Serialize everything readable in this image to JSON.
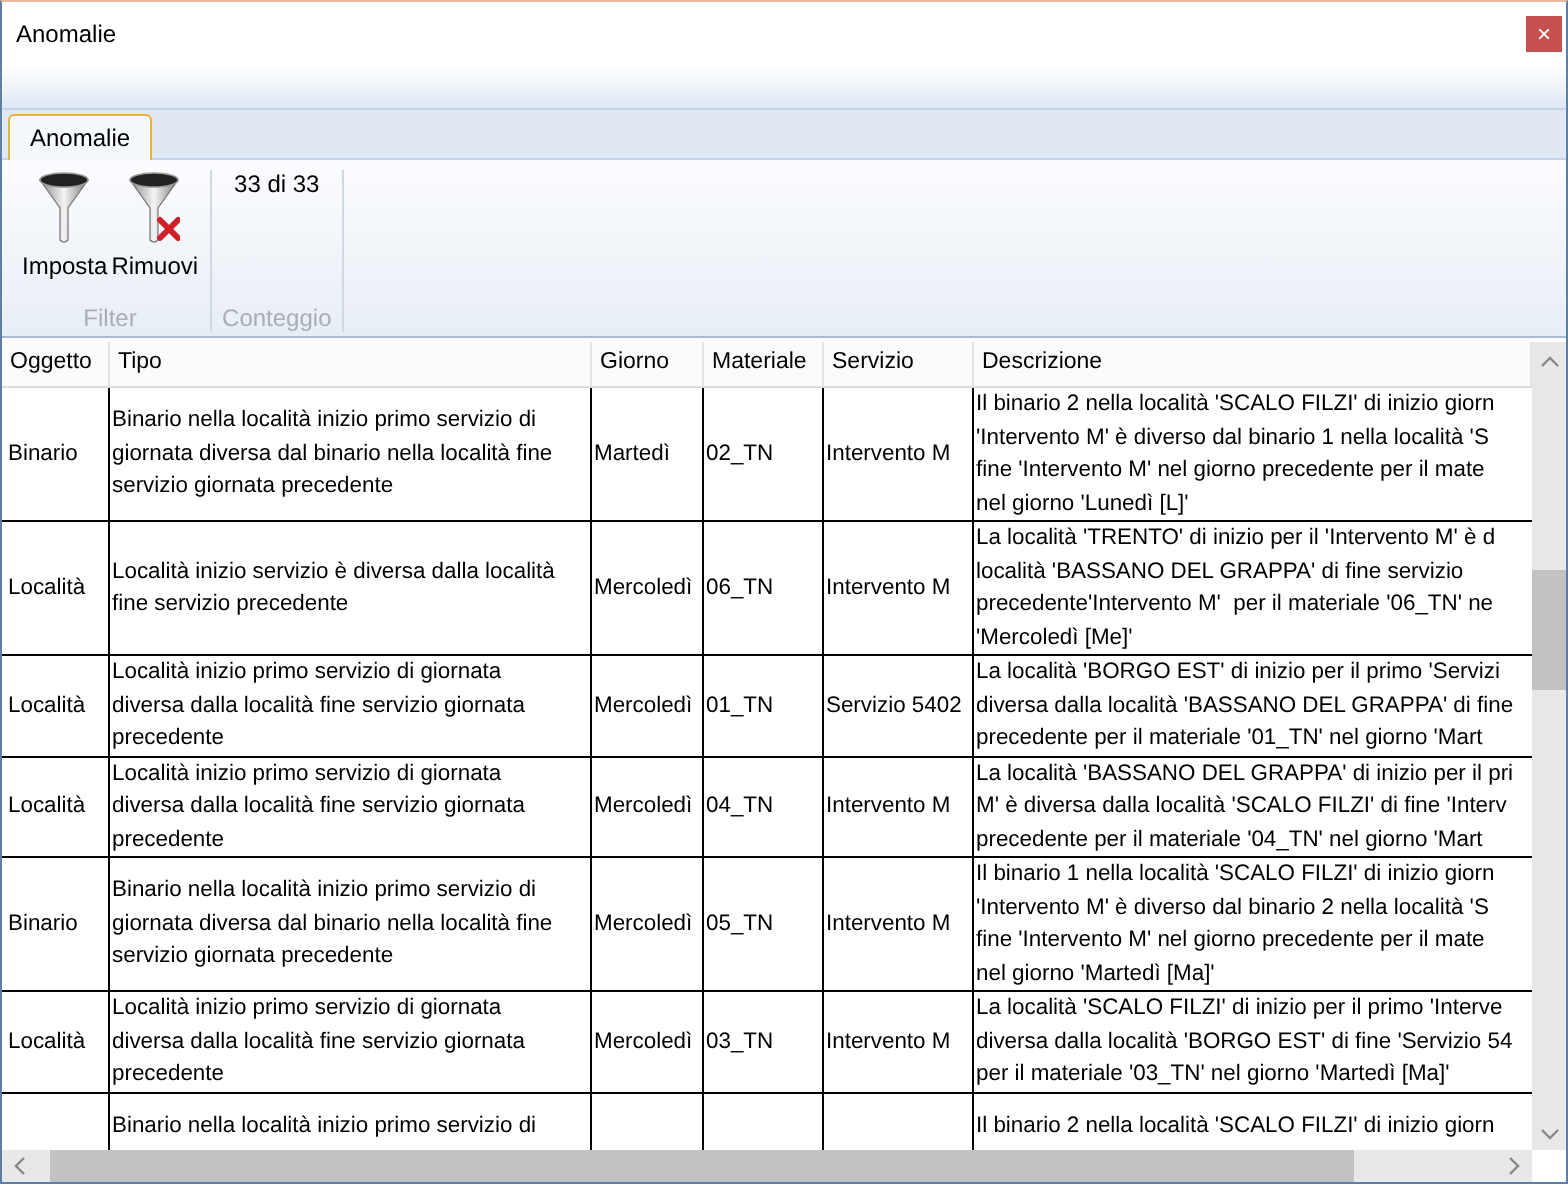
{
  "window": {
    "title": "Anomalie",
    "close": "×"
  },
  "ribbon": {
    "tabs": [
      {
        "label": "Anomalie",
        "selected": true
      }
    ],
    "groups": [
      {
        "label": "Filter",
        "buttons": [
          {
            "label": "Imposta",
            "kind": "funnel"
          },
          {
            "label": "Rimuovi",
            "kind": "funnel-remove"
          }
        ]
      },
      {
        "label": "Conteggio",
        "count": "33 di 33"
      }
    ]
  },
  "table": {
    "columns": [
      "Oggetto",
      "Tipo",
      "Giorno",
      "Materiale",
      "Servizio",
      "Descrizione"
    ],
    "rows": [
      {
        "oggetto": "Binario",
        "tipo": "Binario nella località inizio primo servizio di\ngiornata diversa dal binario nella località fine\nservizio giornata precedente",
        "giorno": "Martedì",
        "materiale": "02_TN",
        "servizio": "Intervento M",
        "descrizione": "Il binario 2 nella località 'SCALO FILZI' di inizio giorn\n'Intervento M' è diverso dal binario 1 nella località 'S\nfine 'Intervento M' nel giorno precedente per il mate\nnel giorno 'Lunedì [L]'"
      },
      {
        "oggetto": "Località",
        "tipo": "Località inizio servizio è diversa dalla località\nfine servizio precedente",
        "giorno": "Mercoledì",
        "materiale": "06_TN",
        "servizio": "Intervento M",
        "descrizione": "La località 'TRENTO' di inizio per il 'Intervento M' è d\nlocalità 'BASSANO DEL GRAPPA' di fine servizio\nprecedente'Intervento M'  per il materiale '06_TN' ne\n'Mercoledì [Me]'"
      },
      {
        "oggetto": "Località",
        "tipo": "Località inizio primo servizio di giornata\ndiversa dalla località fine servizio giornata\nprecedente",
        "giorno": "Mercoledì",
        "materiale": "01_TN",
        "servizio": "Servizio 5402",
        "descrizione": "La località 'BORGO EST' di inizio per il primo 'Servizi\ndiversa dalla località 'BASSANO DEL GRAPPA' di fine\nprecedente per il materiale '01_TN' nel giorno 'Mart"
      },
      {
        "oggetto": "Località",
        "tipo": "Località inizio primo servizio di giornata\ndiversa dalla località fine servizio giornata\nprecedente",
        "giorno": "Mercoledì",
        "materiale": "04_TN",
        "servizio": "Intervento M",
        "descrizione": "La località 'BASSANO DEL GRAPPA' di inizio per il pri\nM' è diversa dalla località 'SCALO FILZI' di fine 'Interv\nprecedente per il materiale '04_TN' nel giorno 'Mart"
      },
      {
        "oggetto": "Binario",
        "tipo": "Binario nella località inizio primo servizio di\ngiornata diversa dal binario nella località fine\nservizio giornata precedente",
        "giorno": "Mercoledì",
        "materiale": "05_TN",
        "servizio": "Intervento M",
        "descrizione": "Il binario 1 nella località 'SCALO FILZI' di inizio giorn\n'Intervento M' è diverso dal binario 2 nella località 'S\nfine 'Intervento M' nel giorno precedente per il mate\nnel giorno 'Martedì [Ma]'"
      },
      {
        "oggetto": "Località",
        "tipo": "Località inizio primo servizio di giornata\ndiversa dalla località fine servizio giornata\nprecedente",
        "giorno": "Mercoledì",
        "materiale": "03_TN",
        "servizio": "Intervento M",
        "descrizione": "La località 'SCALO FILZI' di inizio per il primo 'Interve\ndiversa dalla località 'BORGO EST' di fine 'Servizio 54\nper il materiale '03_TN' nel giorno 'Martedì [Ma]'"
      },
      {
        "tipo": "Binario nella località inizio primo servizio di",
        "descrizione": "Il binario 2 nella località 'SCALO FILZI' di inizio giorn"
      }
    ]
  }
}
